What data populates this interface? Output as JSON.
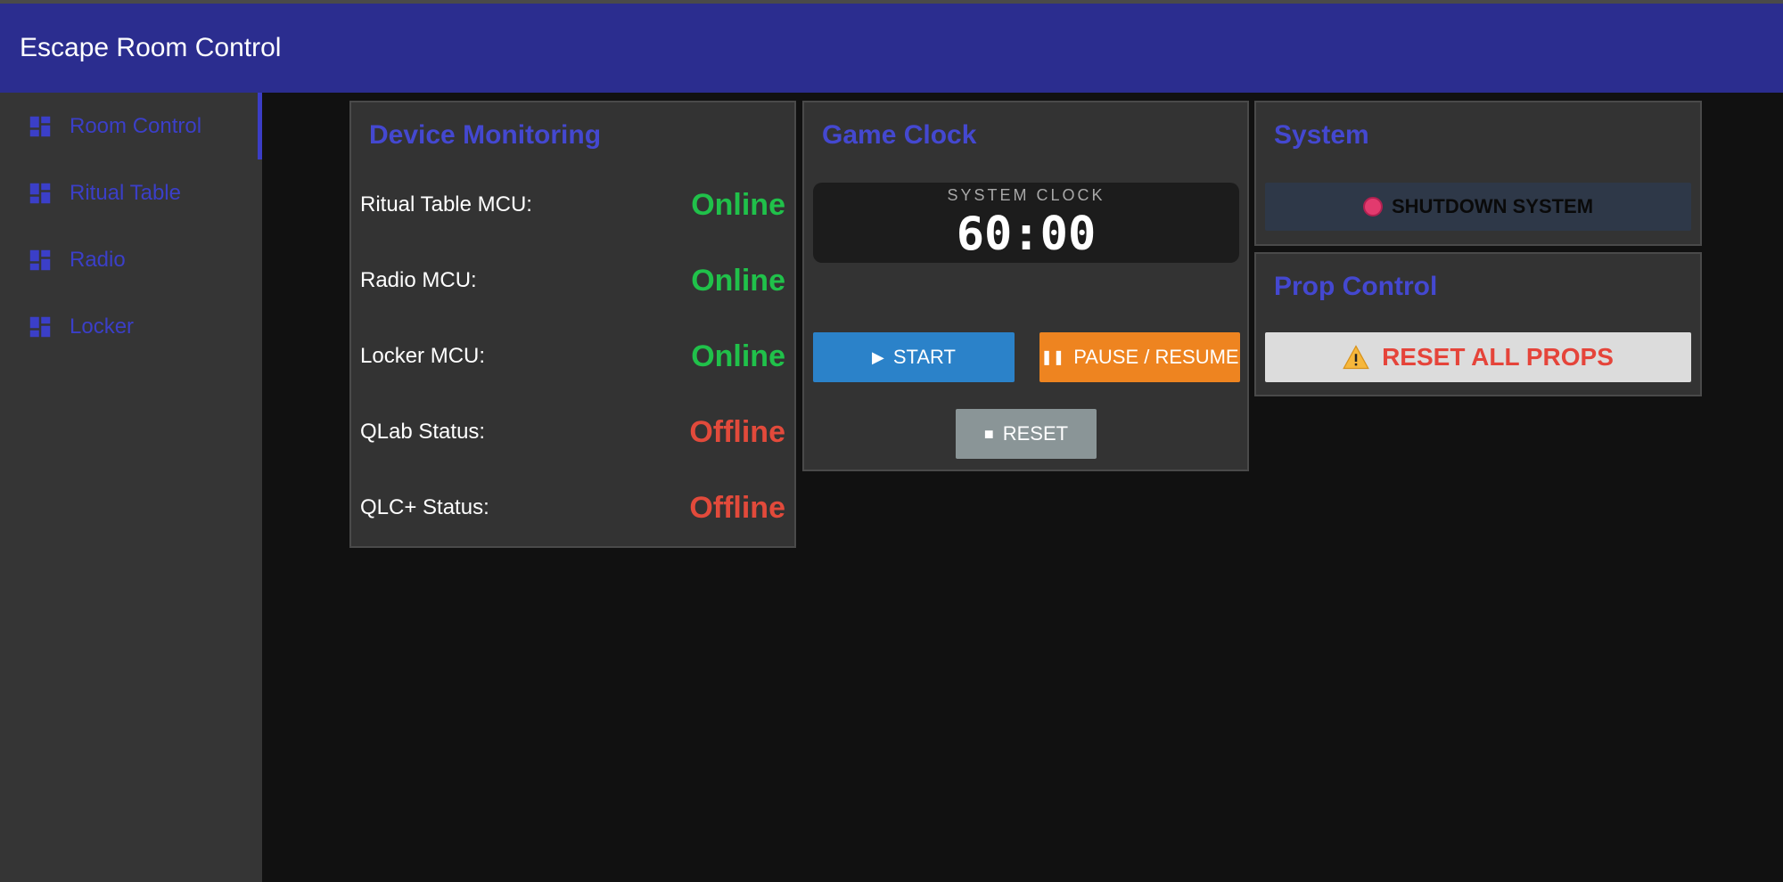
{
  "app": {
    "title": "Escape Room Control"
  },
  "sidebar": {
    "items": [
      {
        "label": "Room Control",
        "icon": "dashboard-icon",
        "active": true
      },
      {
        "label": "Ritual Table",
        "icon": "dashboard-icon",
        "active": false
      },
      {
        "label": "Radio",
        "icon": "dashboard-icon",
        "active": false
      },
      {
        "label": "Locker",
        "icon": "dashboard-icon",
        "active": false
      }
    ]
  },
  "device_monitoring": {
    "title": "Device Monitoring",
    "devices": [
      {
        "label": "Ritual Table MCU:",
        "status": "Online"
      },
      {
        "label": "Radio MCU:",
        "status": "Online"
      },
      {
        "label": "Locker MCU:",
        "status": "Online"
      },
      {
        "label": "QLab Status:",
        "status": "Offline"
      },
      {
        "label": "QLC+ Status:",
        "status": "Offline"
      }
    ]
  },
  "game_clock": {
    "title": "Game Clock",
    "caption": "SYSTEM CLOCK",
    "time": "60:00",
    "start_label": "START",
    "pause_label": "PAUSE / RESUME",
    "reset_label": "RESET"
  },
  "system": {
    "title": "System",
    "shutdown_label": "SHUTDOWN SYSTEM"
  },
  "prop_control": {
    "title": "Prop Control",
    "reset_props_label": "RESET ALL PROPS"
  },
  "colors": {
    "header": "#2b2d8f",
    "accent": "#4448d0",
    "online": "#20c14a",
    "offline": "#e24a3b",
    "start": "#2b82c9",
    "pause": "#ee8420",
    "reset": "#8a9597"
  }
}
